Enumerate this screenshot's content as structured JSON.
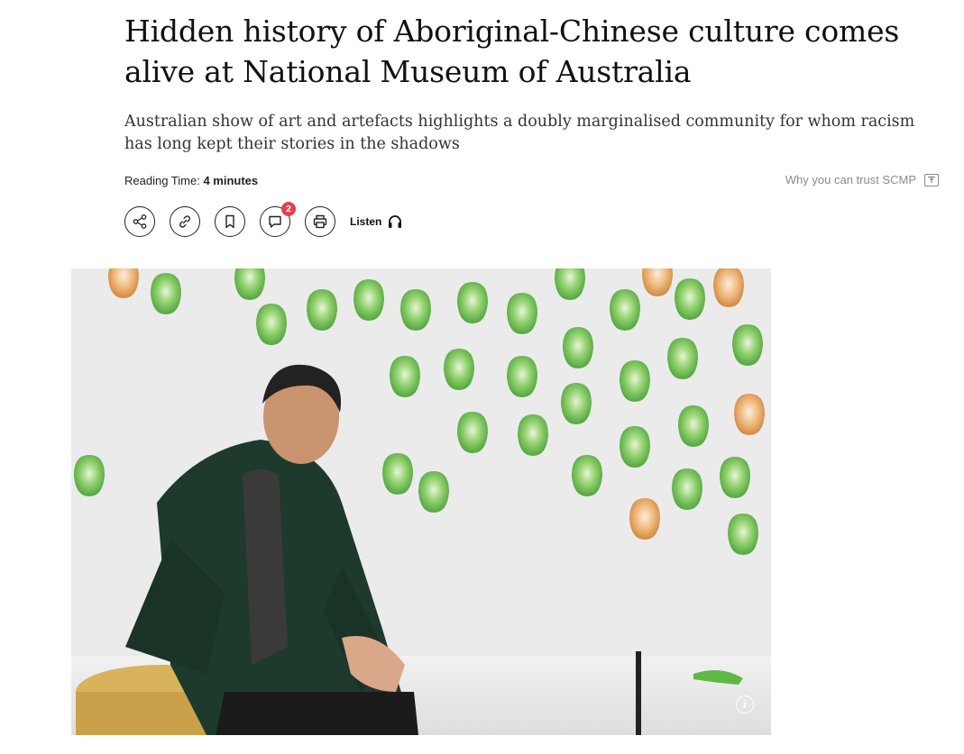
{
  "article": {
    "headline": "Hidden history of Aboriginal-Chinese culture comes alive at National Museum of Australia",
    "subheadline": "Australian show of art and artefacts highlights a doubly marginalised community for whom racism has long kept their stories in the shadows",
    "reading_time_label": "Reading Time:",
    "reading_time_value": "4 minutes",
    "trust_link": "Why you can trust SCMP"
  },
  "toolbar": {
    "buttons": [
      {
        "name": "share",
        "icon": "share-icon"
      },
      {
        "name": "copy-link",
        "icon": "link-icon"
      },
      {
        "name": "bookmark",
        "icon": "bookmark-icon"
      },
      {
        "name": "comments",
        "icon": "comment-icon",
        "count": "2"
      },
      {
        "name": "print",
        "icon": "printer-icon"
      }
    ],
    "listen_label": "Listen",
    "listen_icon": "headphones-icon"
  },
  "hero": {
    "info_icon": "info-icon",
    "info_label": "i"
  },
  "colors": {
    "badge": "#e0424f",
    "trust_text": "#8a8a8a",
    "cabbage_green": "#6fbf4a",
    "cabbage_orange": "#e9a65a"
  }
}
